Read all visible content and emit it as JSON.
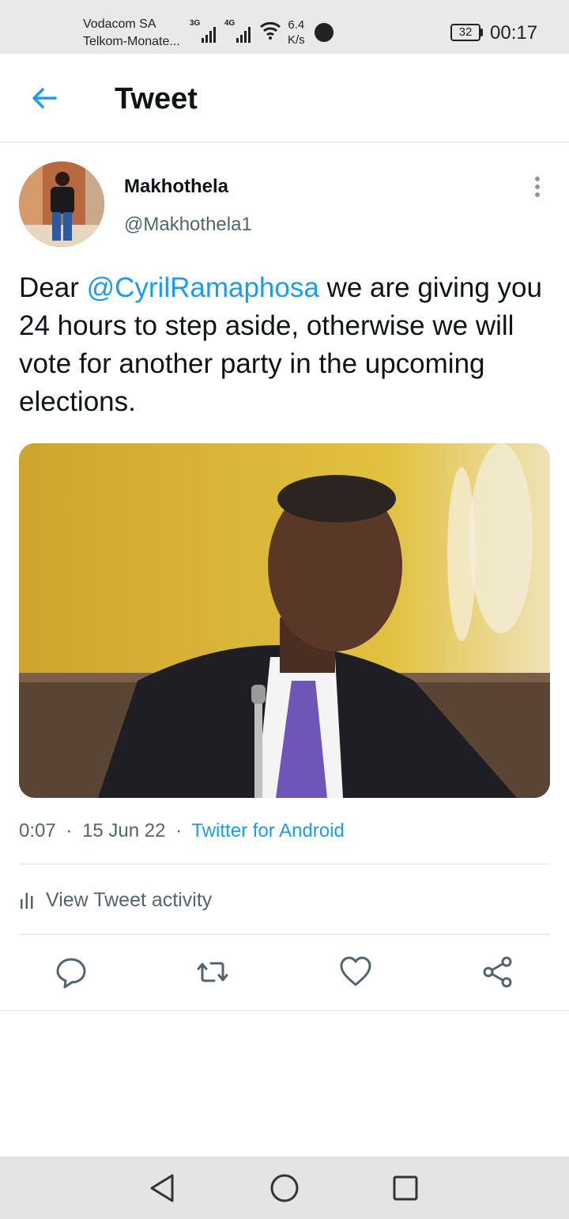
{
  "status_bar": {
    "carrier_1": "Vodacom SA",
    "carrier_2": "Telkom-Monate...",
    "signal_1_type": "3G",
    "signal_2_type": "4G",
    "net_speed_value": "6.4",
    "net_speed_unit": "K/s",
    "battery_level": "32",
    "time": "00:17"
  },
  "header": {
    "title": "Tweet",
    "back_icon": "arrow-left-icon"
  },
  "tweet": {
    "author_name": "Makhothela",
    "author_handle": "@Makhothela1",
    "text_prefix": "Dear ",
    "mention": "@CyrilRamaphosa",
    "text_suffix": " we are giving you 24 hours to step aside, otherwise we will vote for another party in the upcoming elections.",
    "time": "0:07",
    "separator": "·",
    "date": "15 Jun 22",
    "source": "Twitter for Android",
    "activity_label": "View Tweet activity"
  },
  "actions": {
    "icons": [
      "reply-icon",
      "retweet-icon",
      "like-icon",
      "share-icon"
    ]
  },
  "nav_bar": {
    "icons": [
      "back-triangle-icon",
      "home-circle-icon",
      "recents-square-icon"
    ]
  },
  "colors": {
    "accent": "#1d9bf0",
    "text": "#0f1419",
    "muted": "#536471",
    "status_bar_bg": "#e9e9e9",
    "nav_bar_bg": "#e4e4e4"
  }
}
